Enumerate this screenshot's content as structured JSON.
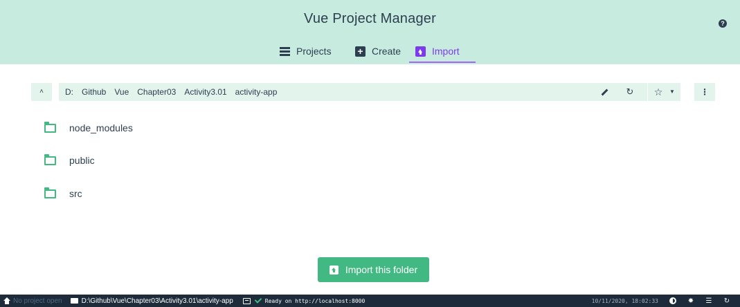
{
  "header": {
    "title": "Vue Project Manager",
    "help_icon": "question-circle-icon",
    "tabs": [
      {
        "label": "Projects",
        "icon": "list-icon"
      },
      {
        "label": "Create",
        "icon": "plus-box-icon"
      },
      {
        "label": "Import",
        "icon": "import-box-icon",
        "active": true
      }
    ]
  },
  "pathbar": {
    "up_icon": "chevron-up-icon",
    "crumbs": [
      "D:",
      "Github",
      "Vue",
      "Chapter03",
      "Activity3.01",
      "activity-app"
    ],
    "edit_icon": "pencil-icon",
    "refresh_icon": "refresh-icon",
    "star_icon": "star-icon",
    "dropdown_icon": "caret-down-icon",
    "more_icon": "more-vertical-icon"
  },
  "folders": [
    {
      "name": "node_modules"
    },
    {
      "name": "public"
    },
    {
      "name": "src"
    }
  ],
  "import_button": {
    "label": "Import this folder"
  },
  "statusbar": {
    "project": "No project open",
    "path": "D:\\Github\\Vue\\Chapter03\\Activity3.01\\activity-app",
    "log": "Ready on http://localhost:8000",
    "datetime": "10/11/2020, 18:02:33"
  },
  "colors": {
    "header_bg": "#c8ebdf",
    "accent_green": "#42b983",
    "accent_purple": "#7c3aed",
    "statusbar_bg": "#1d2b3a"
  }
}
